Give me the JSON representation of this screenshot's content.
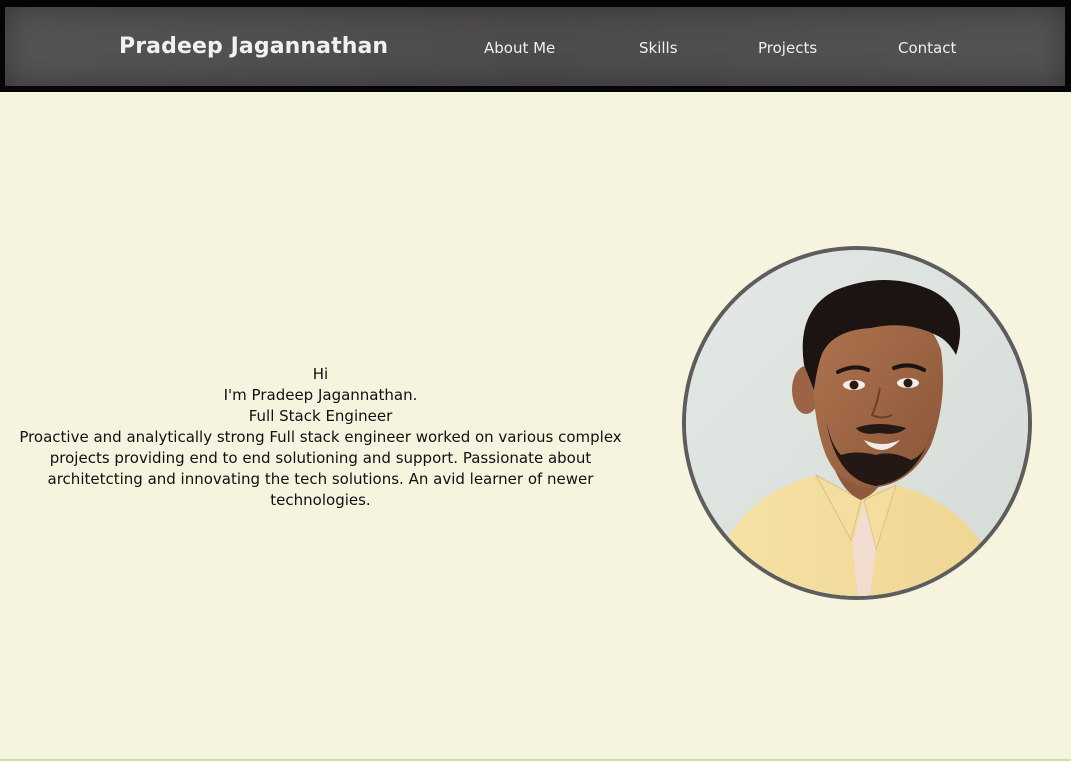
{
  "header": {
    "brand": "Pradeep Jagannathan",
    "nav": [
      {
        "label": "About Me"
      },
      {
        "label": "Skills"
      },
      {
        "label": "Projects"
      },
      {
        "label": "Contact"
      }
    ]
  },
  "intro": {
    "greeting": "Hi",
    "name_line": "I'm Pradeep Jagannathan.",
    "role": "Full Stack Engineer",
    "summary": "Proactive and analytically strong Full stack engineer worked on various complex projects providing end to end solutioning and support. Passionate about architetcting and innovating the tech solutions. An avid learner of newer technologies."
  },
  "profile_photo": {
    "subject": "portrait of a man with dark hair and beard wearing a pale yellow shirt"
  },
  "colors": {
    "page_background": "#f4f4df",
    "navbar": "#4f4d4d",
    "navbar_frame": "#050505",
    "photo_border": "#5e5c5c",
    "nav_text": "#f0f0f0"
  }
}
